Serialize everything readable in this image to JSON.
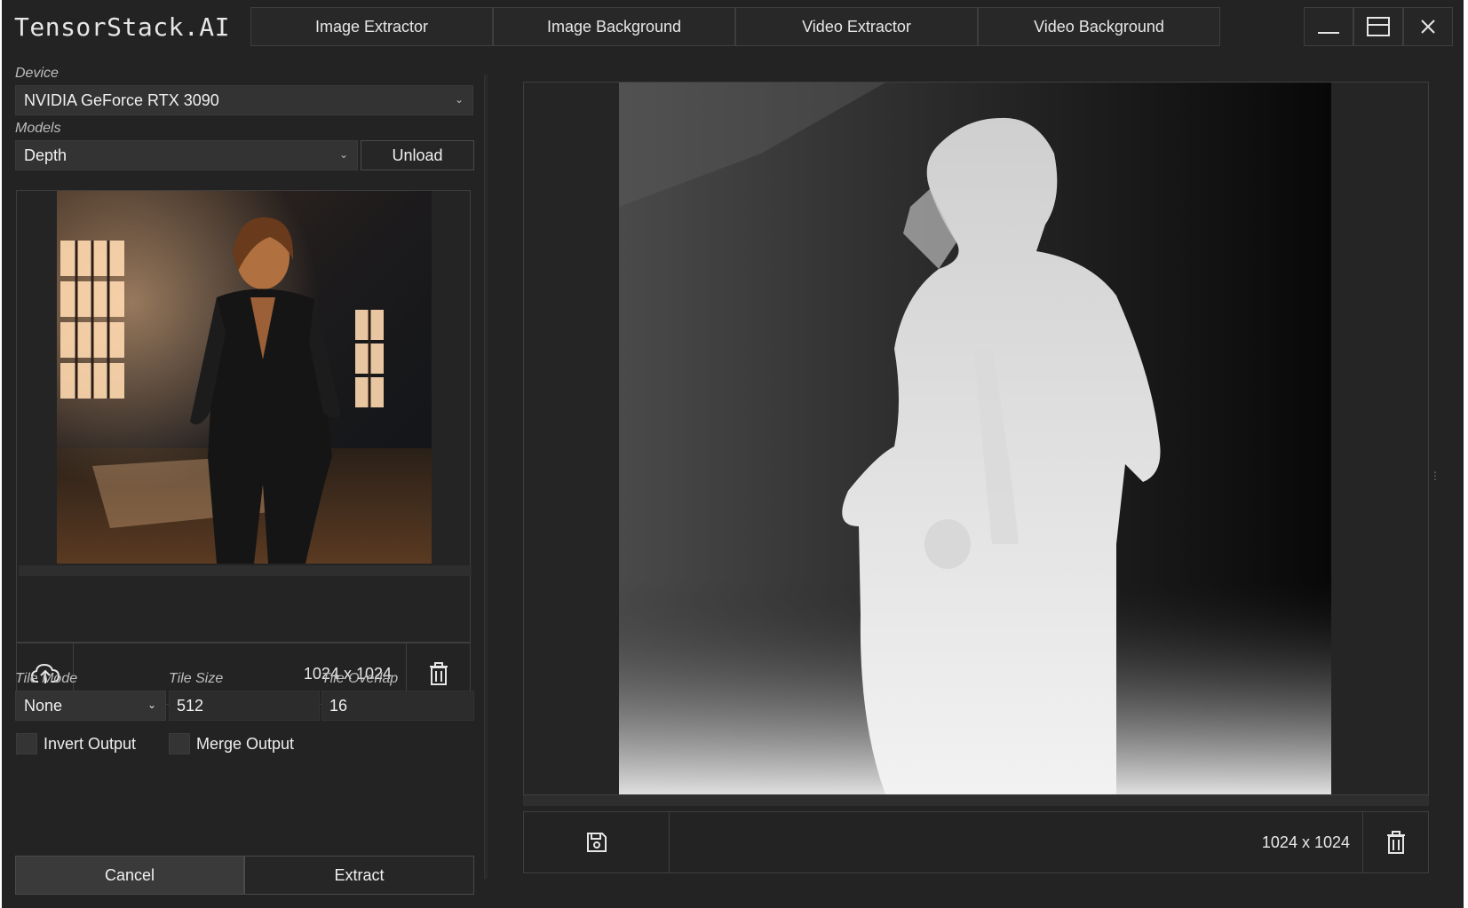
{
  "app": {
    "title": "TensorStack.AI"
  },
  "tabs": [
    "Image Extractor",
    "Image Background",
    "Video Extractor",
    "Video Background"
  ],
  "window_controls": {
    "minimize_icon": "minimize-icon",
    "maximize_icon": "maximize-icon",
    "close_icon": "close-icon"
  },
  "device": {
    "label": "Device",
    "value": "NVIDIA GeForce RTX 3090"
  },
  "models": {
    "label": "Models",
    "value": "Depth",
    "unload_label": "Unload"
  },
  "input_image": {
    "dimensions": "1024 x 1024",
    "upload_icon": "cloud-upload-icon",
    "delete_icon": "trash-icon"
  },
  "tile": {
    "mode_label": "Tile Mode",
    "mode_value": "None",
    "size_label": "Tile Size",
    "size_value": "512",
    "overlap_label": "Tile Overlap",
    "overlap_value": "16"
  },
  "options": {
    "invert_label": "Invert Output",
    "invert_checked": false,
    "merge_label": "Merge Output",
    "merge_checked": false
  },
  "actions": {
    "cancel_label": "Cancel",
    "extract_label": "Extract"
  },
  "output_image": {
    "dimensions": "1024 x 1024",
    "save_icon": "save-icon",
    "delete_icon": "trash-icon"
  },
  "colors": {
    "background": "#232323",
    "border": "#3e3e3e",
    "text": "#e8e8e8"
  }
}
